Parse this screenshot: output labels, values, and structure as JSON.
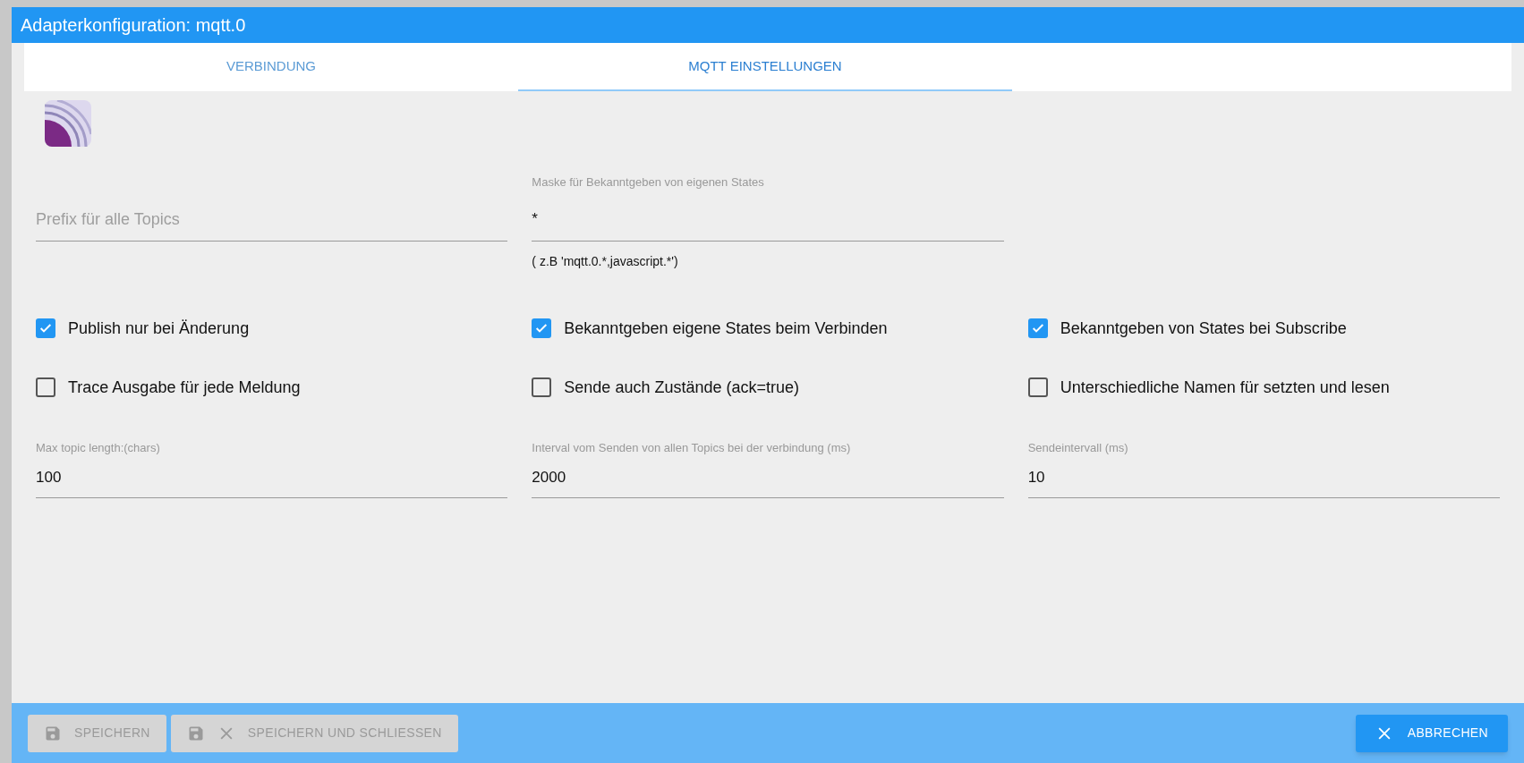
{
  "window": {
    "title": "Adapterkonfiguration: mqtt.0"
  },
  "tabs": [
    {
      "label": "VERBINDUNG",
      "selected": false
    },
    {
      "label": "MQTT EINSTELLUNGEN",
      "selected": true
    }
  ],
  "top_fields": [
    {
      "placeholder": "Prefix für alle Topics"
    },
    {
      "label": "Maske für Bekanntgeben von eigenen States",
      "value": "*",
      "helper": "( z.B 'mqtt.0.*,javascript.*')"
    }
  ],
  "checkboxes": [
    {
      "label": "Publish nur bei Änderung",
      "checked": true
    },
    {
      "label": "Bekanntgeben eigene States beim Verbinden",
      "checked": true
    },
    {
      "label": "Bekanntgeben von States bei Subscribe",
      "checked": true
    },
    {
      "label": "Trace Ausgabe für jede Meldung",
      "checked": false
    },
    {
      "label": "Sende auch Zustände (ack=true)",
      "checked": false
    },
    {
      "label": "Unterschiedliche Namen für setzten und lesen",
      "checked": false
    }
  ],
  "number_fields": [
    {
      "label": "Max topic length:(chars)",
      "value": "100"
    },
    {
      "label": "Interval vom Senden von allen Topics bei der verbindung (ms)",
      "value": "2000"
    },
    {
      "label": "Sendeintervall (ms)",
      "value": "10"
    }
  ],
  "buttons": [
    {
      "label": "SPEICHERN",
      "disabled": true
    },
    {
      "label": "SPEICHERN UND SCHLIESSEN",
      "disabled": true
    },
    {
      "label": "ABBRECHEN",
      "disabled": false
    }
  ]
}
